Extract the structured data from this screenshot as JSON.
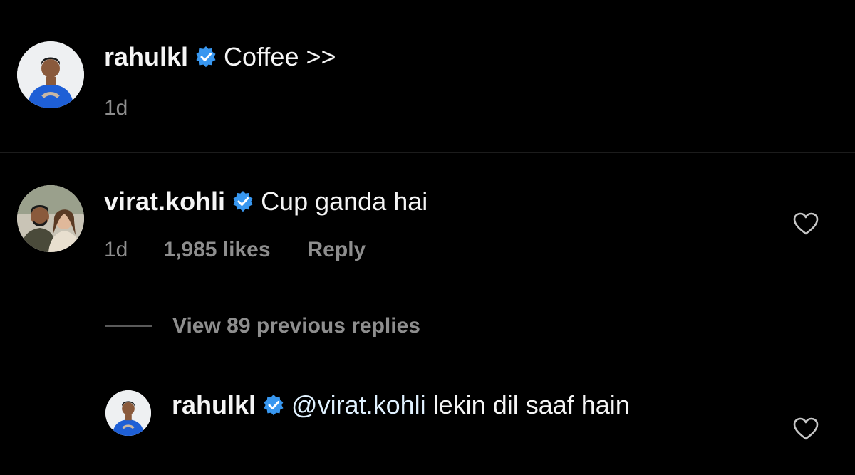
{
  "comments": [
    {
      "username": "rahulkl",
      "text": "Coffee >>",
      "time": "1d"
    },
    {
      "username": "virat.kohli",
      "text": "Cup ganda hai",
      "time": "1d",
      "likes": "1,985 likes",
      "reply_label": "Reply",
      "view_replies": "View 89 previous replies"
    }
  ],
  "reply": {
    "username": "rahulkl",
    "mention": "@virat.kohli",
    "text": " lekin dil saaf hain"
  },
  "colors": {
    "background": "#000000",
    "verified_badge": "#3897f0",
    "muted_text": "#8e8e8e",
    "mention": "#e0f1ff"
  },
  "icons": {
    "verified": "verified-badge-icon",
    "like": "heart-outline-icon"
  }
}
